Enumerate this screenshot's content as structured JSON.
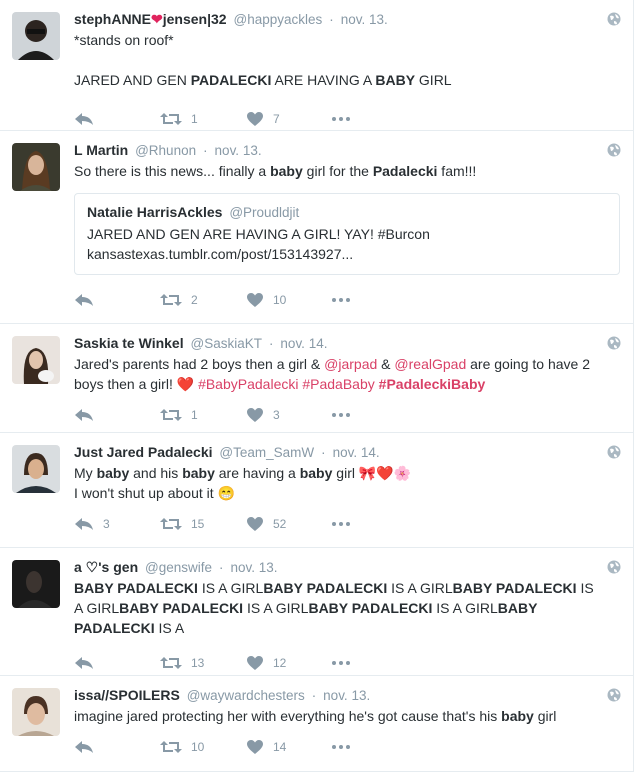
{
  "tweets": [
    {
      "fullname": "stephANNE",
      "fullname_suffix": "jensen|32",
      "handle": "@happyackles",
      "time": "nov. 13.",
      "text_line1": "*stands on roof*",
      "segments": [
        {
          "t": "JARED AND GEN ",
          "s": "n"
        },
        {
          "t": "PADALECKI",
          "s": "b"
        },
        {
          "t": " ARE HAVING A ",
          "s": "n"
        },
        {
          "t": "BABY",
          "s": "b"
        },
        {
          "t": " GIRL",
          "s": "n"
        }
      ],
      "reply_count": "",
      "retweet_count": "1",
      "like_count": "7"
    },
    {
      "fullname": "L Martin",
      "handle": "@Rhunon",
      "time": "nov. 13.",
      "segments": [
        {
          "t": "So there is this news... finally a ",
          "s": "n"
        },
        {
          "t": "baby",
          "s": "b"
        },
        {
          "t": " girl for the ",
          "s": "n"
        },
        {
          "t": "Padalecki",
          "s": "b"
        },
        {
          "t": " fam!!!",
          "s": "n"
        }
      ],
      "quote": {
        "name": "Natalie HarrisAckles",
        "handle": "@Proudldjit",
        "line1": "JARED AND GEN ARE HAVING A GIRL! YAY! #Burcon",
        "line2": "kansastexas.tumblr.com/post/153143927..."
      },
      "reply_count": "",
      "retweet_count": "2",
      "like_count": "10"
    },
    {
      "fullname": "Saskia te Winkel",
      "handle": "@SaskiaKT",
      "time": "nov. 14.",
      "segments": [
        {
          "t": "Jared's parents had 2 boys then a girl & ",
          "s": "n"
        },
        {
          "t": "@jarpad",
          "s": "m"
        },
        {
          "t": " & ",
          "s": "n"
        },
        {
          "t": "@realGpad",
          "s": "m"
        },
        {
          "t": " are going to have 2 boys then a girl! ",
          "s": "n"
        },
        {
          "t": "❤️",
          "s": "e"
        },
        {
          "t": " ",
          "s": "n"
        },
        {
          "t": "#BabyPadalecki",
          "s": "h"
        },
        {
          "t": " ",
          "s": "n"
        },
        {
          "t": "#PadaBaby",
          "s": "h"
        },
        {
          "t": " ",
          "s": "n"
        },
        {
          "t": "#PadaleckiBaby",
          "s": "hb"
        }
      ],
      "reply_count": "",
      "retweet_count": "1",
      "like_count": "3"
    },
    {
      "fullname": "Just Jared Padalecki",
      "handle": "@Team_SamW",
      "time": "nov. 14.",
      "segments": [
        {
          "t": "My ",
          "s": "n"
        },
        {
          "t": "baby",
          "s": "b"
        },
        {
          "t": " and his ",
          "s": "n"
        },
        {
          "t": "baby",
          "s": "b"
        },
        {
          "t": " are having a ",
          "s": "n"
        },
        {
          "t": "baby",
          "s": "b"
        },
        {
          "t": " girl ",
          "s": "n"
        },
        {
          "t": "🎀❤️🌸",
          "s": "e"
        }
      ],
      "text_line2": "I won't shut up about it 😁",
      "reply_count": "3",
      "retweet_count": "15",
      "like_count": "52"
    },
    {
      "fullname": "a ♡'s gen",
      "handle": "@genswife",
      "time": "nov. 13.",
      "segments": [
        {
          "t": "BABY PADALECKI",
          "s": "b"
        },
        {
          "t": " IS A GIRL",
          "s": "n"
        },
        {
          "t": "BABY PADALECKI",
          "s": "b"
        },
        {
          "t": " IS A GIRL",
          "s": "n"
        },
        {
          "t": "BABY PADALECKI",
          "s": "b"
        },
        {
          "t": " IS A GIRL",
          "s": "n"
        },
        {
          "t": "BABY PADALECKI",
          "s": "b"
        },
        {
          "t": " IS A GIRL",
          "s": "n"
        },
        {
          "t": "BABY PADALECKI",
          "s": "b"
        },
        {
          "t": " IS A GIRL",
          "s": "n"
        },
        {
          "t": "BABY PADALECKI",
          "s": "b"
        },
        {
          "t": " IS A",
          "s": "n"
        }
      ],
      "reply_count": "",
      "retweet_count": "13",
      "like_count": "12"
    },
    {
      "fullname": "issa//SPOILERS",
      "handle": "@waywardchesters",
      "time": "nov. 13.",
      "segments": [
        {
          "t": "imagine jared protecting her with everything he's got cause that's his ",
          "s": "n"
        },
        {
          "t": "baby",
          "s": "b"
        },
        {
          "t": " girl",
          "s": "n"
        }
      ],
      "reply_count": "",
      "retweet_count": "10",
      "like_count": "14"
    }
  ],
  "colors": {
    "link": "#d94167",
    "meta": "#8899a6",
    "text": "#292f33",
    "heart": "#e0245e"
  },
  "icons": [
    "reply-icon",
    "retweet-icon",
    "like-icon",
    "more-icon",
    "globe-icon"
  ]
}
